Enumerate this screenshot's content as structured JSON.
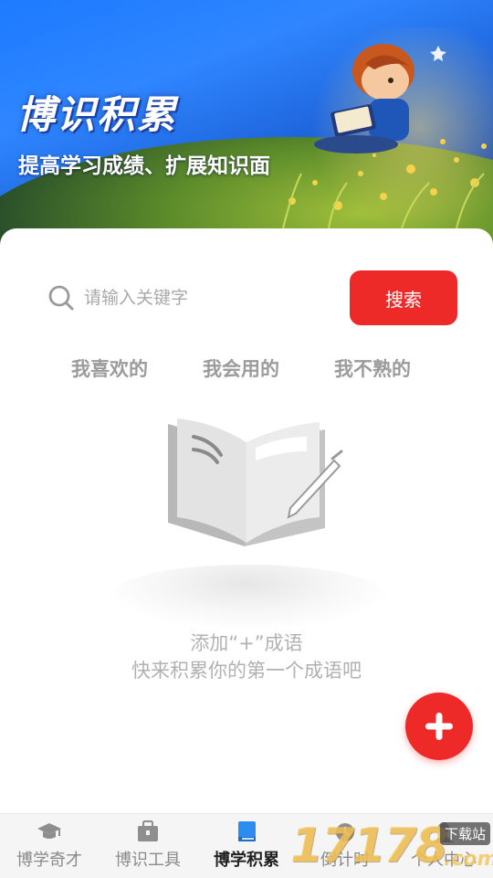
{
  "hero": {
    "title": "博识积累",
    "subtitle": "提高学习成绩、扩展知识面"
  },
  "search": {
    "placeholder": "请输入关键字",
    "button_label": "搜索"
  },
  "tabs": [
    "我喜欢的",
    "我会用的",
    "我不熟的"
  ],
  "empty_state": {
    "line1": "添加“+”成语",
    "line2": "快来积累你的第一个成语吧"
  },
  "nav": {
    "items": [
      {
        "label": "博学奇才",
        "icon": "graduation-cap-icon"
      },
      {
        "label": "博识工具",
        "icon": "toolbox-icon"
      },
      {
        "label": "博学积累",
        "icon": "book-icon",
        "active": true
      },
      {
        "label": "倒计时",
        "icon": "alarm-clock-icon"
      },
      {
        "label": "个人中心",
        "icon": "user-icon"
      }
    ]
  },
  "watermark": {
    "numbers": "17178",
    "tag": "下载站",
    "suffix": ".com"
  },
  "colors": {
    "accent": "#ee2a28",
    "hero_blue": "#2f86ff",
    "muted_text": "#9b9b9b",
    "active_nav_icon": "#2d8cf0"
  }
}
